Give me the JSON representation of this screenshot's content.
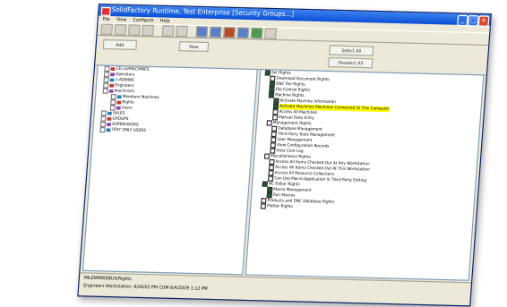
{
  "window": {
    "title": "SolidFactory Runtime, Test Enterprise [Security Groups...]"
  },
  "menu": [
    "File",
    "View",
    "Configure",
    "Help"
  ],
  "toolbar": {
    "buttons": [
      "tb1",
      "tb2",
      "tb3",
      "tb4",
      "tb5",
      "tb6",
      "tb7",
      "tb8",
      "tb9",
      "tb10",
      "tb11",
      "tb12"
    ]
  },
  "controls": {
    "add": "Add",
    "new": "New",
    "select_all": "Select All",
    "deselect_all": "Deselect All"
  },
  "left_tree": [
    {
      "label": "CELLS/MACHINES",
      "icon": "cell-icon"
    },
    {
      "label": "Operators",
      "icon": "operator-icon"
    },
    {
      "label": "1-ADMINS",
      "icon": "admin-icon"
    },
    {
      "label": "Engineers",
      "icon": "engineer-icon"
    },
    {
      "label": "Machinists",
      "icon": "machinist-icon"
    },
    {
      "label": "Members Machines",
      "icon": "member-icon"
    },
    {
      "label": "Rights",
      "icon": "rights-icon"
    },
    {
      "label": "Users",
      "icon": "users-icon"
    },
    {
      "label": "SALES",
      "icon": "sales-icon"
    },
    {
      "label": "GROUPS",
      "icon": "group-icon"
    },
    {
      "label": "SUPERVISORS",
      "icon": "supervisor-icon"
    },
    {
      "label": "TEST ONLY USERS",
      "icon": "test-icon"
    }
  ],
  "right_tree": [
    {
      "label": "Set Rights",
      "checked": true,
      "indent": 0
    },
    {
      "label": "Download Document Rights",
      "checked": false,
      "indent": 1
    },
    {
      "label": "DNC File Rights",
      "checked": true,
      "indent": 1
    },
    {
      "label": "File Control Rights",
      "checked": true,
      "indent": 1
    },
    {
      "label": "Machine Rights",
      "checked": true,
      "indent": 1
    },
    {
      "label": "Activate Machine Information",
      "checked": true,
      "indent": 2
    },
    {
      "label": "Activate Machines Machines Connected To This Computer",
      "checked": true,
      "indent": 2,
      "highlight": true
    },
    {
      "label": "Access All Machines",
      "checked": false,
      "indent": 2
    },
    {
      "label": "Manual Data Entry",
      "checked": false,
      "indent": 2
    },
    {
      "label": "Management Rights",
      "checked": false,
      "indent": 1
    },
    {
      "label": "Database Management",
      "checked": false,
      "indent": 2
    },
    {
      "label": "Third Party Tools Management",
      "checked": false,
      "indent": 2
    },
    {
      "label": "User Management",
      "checked": false,
      "indent": 2
    },
    {
      "label": "View Configuration Records",
      "checked": false,
      "indent": 2
    },
    {
      "label": "View Core Log",
      "checked": false,
      "indent": 2
    },
    {
      "label": "Miscellaneous Rights",
      "checked": false,
      "indent": 1
    },
    {
      "label": "Access All Items Checked Out At Any Workstation",
      "checked": false,
      "indent": 2
    },
    {
      "label": "Access All Items Checked Out At This Workstation",
      "checked": false,
      "indent": 2
    },
    {
      "label": "Access All Resource Collections",
      "checked": false,
      "indent": 2
    },
    {
      "label": "Can Use Macro-Application In Third Party Editing",
      "checked": false,
      "indent": 2
    },
    {
      "label": "NC Editor Rights",
      "checked": true,
      "indent": 1
    },
    {
      "label": "Macro Management",
      "checked": true,
      "indent": 2
    },
    {
      "label": "Run Macros",
      "checked": true,
      "indent": 2
    },
    {
      "label": "Products and DNC Database Rights",
      "checked": false,
      "indent": 1
    },
    {
      "label": "Plotter Rights",
      "checked": false,
      "indent": 1
    }
  ],
  "status": {
    "line1": "MILEMMWEBUS/Rights",
    "line2": "Engineers Workstation: 6/26/02 PM COM   6/4/2009  1:12 PM"
  }
}
